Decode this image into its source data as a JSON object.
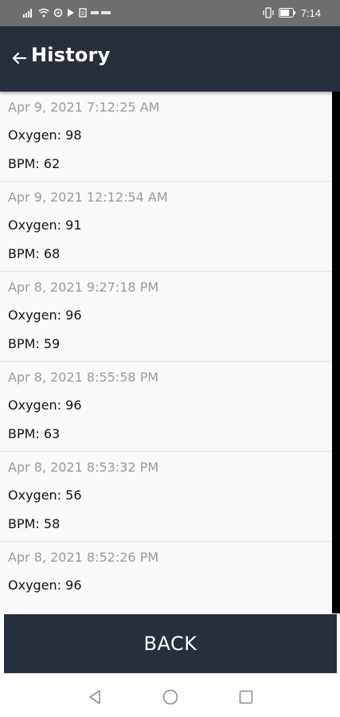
{
  "status_bar": {
    "time": "7:14",
    "left_icons": [
      "signal-icon",
      "wifi-icon",
      "sync-icon",
      "play-icon",
      "image-icon",
      "notification-text-icon"
    ],
    "right_icons": [
      "vibrate-icon",
      "battery-icon"
    ]
  },
  "header": {
    "title": "History"
  },
  "records": [
    {
      "date": "Apr 9, 2021 7:12:25 AM",
      "oxygen": "Oxygen: 98",
      "bpm": "BPM: 62"
    },
    {
      "date": "Apr 9, 2021 12:12:54 AM",
      "oxygen": "Oxygen: 91",
      "bpm": "BPM: 68"
    },
    {
      "date": "Apr 8, 2021 9:27:18 PM",
      "oxygen": "Oxygen: 96",
      "bpm": "BPM: 59"
    },
    {
      "date": "Apr 8, 2021 8:55:58 PM",
      "oxygen": "Oxygen: 96",
      "bpm": "BPM: 63"
    },
    {
      "date": "Apr 8, 2021 8:53:32 PM",
      "oxygen": "Oxygen: 56",
      "bpm": "BPM: 58"
    },
    {
      "date": "Apr 8, 2021 8:52:26 PM",
      "oxygen": "Oxygen: 96",
      "bpm": ""
    }
  ],
  "footer": {
    "back_label": "BACK"
  },
  "nav": {
    "icons": [
      "back-triangle-icon",
      "home-circle-icon",
      "recents-square-icon"
    ]
  },
  "colors": {
    "app_bar": "#272f3d",
    "status_bar": "#6f6f6f",
    "date_text": "#9a9a9a"
  }
}
